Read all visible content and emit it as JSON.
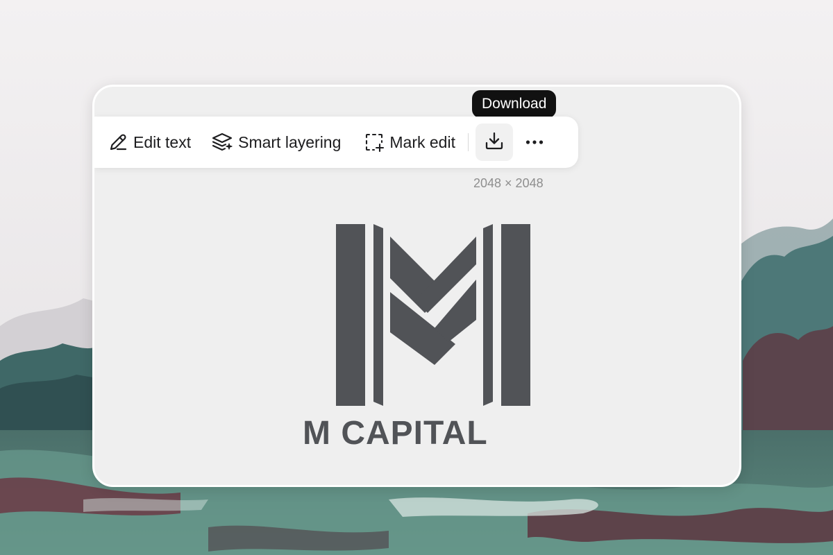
{
  "toolbar": {
    "edit_text_label": "Edit text",
    "smart_layering_label": "Smart layering",
    "mark_edit_label": "Mark edit",
    "download_icon": "download-icon",
    "more_icon": "more-horizontal-icon"
  },
  "tooltip": {
    "label": "Download"
  },
  "image": {
    "dimensions": "2048 × 2048",
    "logo_text": "M CAPITAL"
  },
  "colors": {
    "logo": "#515357",
    "tooltip_bg": "#111111",
    "card_bg": "#efefef"
  }
}
